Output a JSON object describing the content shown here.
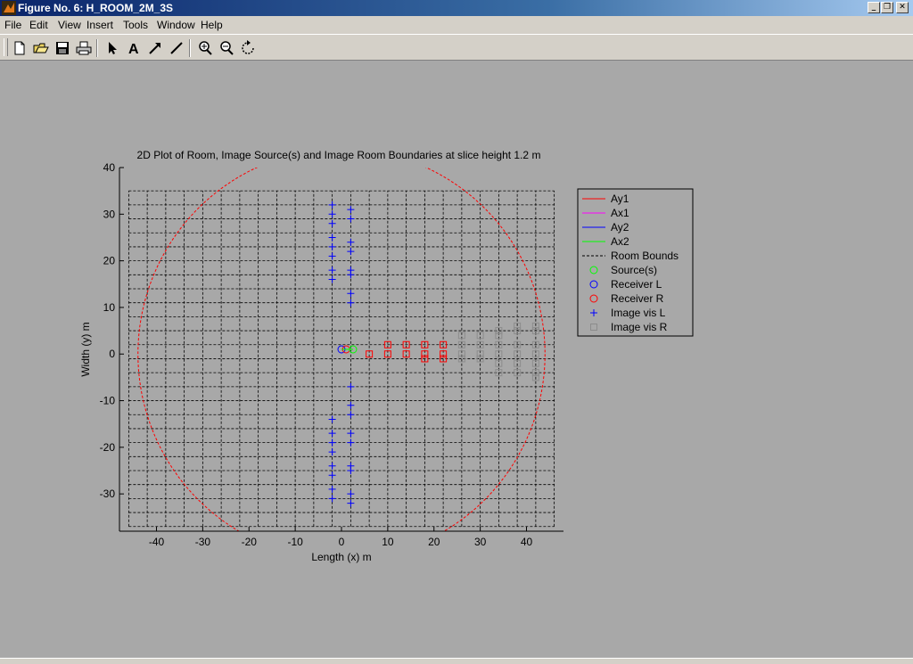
{
  "window": {
    "title": "Figure No. 6: H_ROOM_2M_3S",
    "buttons": [
      "minimize",
      "maximize",
      "close"
    ]
  },
  "menubar": {
    "items": [
      {
        "label": "File"
      },
      {
        "label": "Edit"
      },
      {
        "label": "View"
      },
      {
        "label": "Insert"
      },
      {
        "label": "Tools"
      },
      {
        "label": "Window"
      },
      {
        "label": "Help"
      }
    ]
  },
  "toolbar": {
    "buttons": [
      {
        "name": "new-figure-icon"
      },
      {
        "name": "open-file-icon"
      },
      {
        "name": "save-icon"
      },
      {
        "name": "print-icon"
      },
      {
        "name": "select-arrow-icon"
      },
      {
        "name": "insert-text-icon"
      },
      {
        "name": "insert-arrow-icon"
      },
      {
        "name": "insert-line-icon"
      },
      {
        "name": "zoom-in-icon"
      },
      {
        "name": "zoom-out-icon"
      },
      {
        "name": "rotate-3d-icon"
      }
    ]
  },
  "colors": {
    "background": "#a8a8a8",
    "axes_bg": "#a8a8a8",
    "ay1": "#ff0000",
    "ax1": "#ff00ff",
    "ay2": "#0000ff",
    "ax2": "#00ff00",
    "bounds": "#000000",
    "source": "#00ff00",
    "receiver_l": "#0000ff",
    "receiver_r": "#ff0000",
    "image_vis_l": "#0000ff",
    "image_vis_r_near": "#ff0000",
    "image_vis_r_far": "#8c8c8c"
  },
  "chart_data": {
    "type": "scatter",
    "title": "2D Plot of Room, Image Source(s) and Image Room Boundaries at slice height 1.2 m",
    "xlabel": "Length (x) m",
    "ylabel": "Width (y) m",
    "xlim": [
      -48,
      48
    ],
    "ylim": [
      -38,
      40
    ],
    "xticks": [
      -40,
      -30,
      -20,
      -10,
      0,
      10,
      20,
      30,
      40
    ],
    "yticks": [
      -30,
      -20,
      -10,
      0,
      10,
      20,
      30,
      40
    ],
    "grid": true,
    "legend_position": "outside-right",
    "room_bounds": {
      "x_lines": [
        -46,
        -42,
        -38,
        -34,
        -30,
        -26,
        -22,
        -18,
        -14,
        -10,
        -6,
        -2,
        2,
        6,
        10,
        14,
        18,
        22,
        26,
        30,
        34,
        38,
        42,
        46
      ],
      "y_lines": [
        -37,
        -34,
        -31,
        -28,
        -25,
        -22,
        -19,
        -16,
        -13,
        -10,
        -7,
        -4,
        -1,
        2,
        5,
        8,
        11,
        14,
        17,
        20,
        23,
        26,
        29,
        32,
        35
      ]
    },
    "circle": {
      "center": [
        0,
        0
      ],
      "radius": 44
    },
    "source": [
      [
        2.5,
        1
      ]
    ],
    "receiver_l": [
      [
        0,
        1
      ]
    ],
    "receiver_r": [
      [
        1,
        1
      ]
    ],
    "image_vis_l": [
      [
        -2,
        32
      ],
      [
        -2,
        30
      ],
      [
        -2,
        28
      ],
      [
        -2,
        25
      ],
      [
        -2,
        23
      ],
      [
        -2,
        21
      ],
      [
        -2,
        18
      ],
      [
        -2,
        16
      ],
      [
        2,
        31
      ],
      [
        2,
        29
      ],
      [
        2,
        24
      ],
      [
        2,
        22
      ],
      [
        2,
        18
      ],
      [
        2,
        17
      ],
      [
        2,
        13
      ],
      [
        2,
        11
      ],
      [
        -2,
        -14
      ],
      [
        -2,
        -17
      ],
      [
        -2,
        -19
      ],
      [
        -2,
        -21
      ],
      [
        -2,
        -24
      ],
      [
        -2,
        -26
      ],
      [
        -2,
        -29
      ],
      [
        -2,
        -31
      ],
      [
        2,
        -7
      ],
      [
        2,
        -11
      ],
      [
        2,
        -13
      ],
      [
        2,
        -17
      ],
      [
        2,
        -19
      ],
      [
        2,
        -24
      ],
      [
        2,
        -25
      ],
      [
        2,
        -30
      ],
      [
        2,
        -32
      ]
    ],
    "image_vis_r": [
      [
        6,
        0
      ],
      [
        10,
        2
      ],
      [
        10,
        0
      ],
      [
        14,
        2
      ],
      [
        14,
        0
      ],
      [
        18,
        2
      ],
      [
        18,
        0
      ],
      [
        18,
        -1
      ],
      [
        22,
        2
      ],
      [
        22,
        0
      ],
      [
        22,
        -1
      ],
      [
        26,
        4
      ],
      [
        26,
        2
      ],
      [
        26,
        0
      ],
      [
        26,
        -1
      ],
      [
        30,
        4
      ],
      [
        30,
        2
      ],
      [
        30,
        0
      ],
      [
        30,
        -1
      ],
      [
        34,
        5
      ],
      [
        34,
        4
      ],
      [
        34,
        2
      ],
      [
        34,
        0
      ],
      [
        34,
        -2
      ],
      [
        34,
        -4
      ],
      [
        38,
        6
      ],
      [
        38,
        5
      ],
      [
        38,
        2
      ],
      [
        38,
        0
      ],
      [
        38,
        -2
      ],
      [
        38,
        -4
      ],
      [
        42,
        6
      ],
      [
        42,
        5
      ],
      [
        42,
        2
      ],
      [
        42,
        0
      ],
      [
        42,
        -2
      ],
      [
        42,
        -4
      ],
      [
        42,
        -5
      ]
    ],
    "legend": [
      {
        "label": "Ay1",
        "style": "line",
        "color": "#ff0000"
      },
      {
        "label": "Ax1",
        "style": "line",
        "color": "#ff00ff"
      },
      {
        "label": "Ay2",
        "style": "line",
        "color": "#0000ff"
      },
      {
        "label": "Ax2",
        "style": "line",
        "color": "#00ff00"
      },
      {
        "label": "Room Bounds",
        "style": "dashed",
        "color": "#000000"
      },
      {
        "label": "Source(s)",
        "style": "circle",
        "color": "#00ff00"
      },
      {
        "label": "Receiver L",
        "style": "circle",
        "color": "#0000ff"
      },
      {
        "label": "Receiver R",
        "style": "circle",
        "color": "#ff0000"
      },
      {
        "label": "Image vis L",
        "style": "plus",
        "color": "#0000ff"
      },
      {
        "label": "Image vis R",
        "style": "square",
        "color": "#8c8c8c"
      }
    ]
  }
}
